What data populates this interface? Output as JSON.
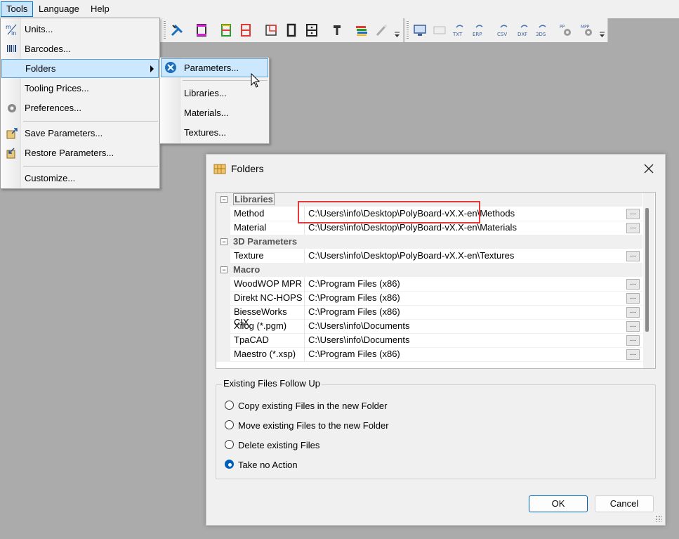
{
  "menubar": {
    "items": [
      "Tools",
      "Language",
      "Help"
    ]
  },
  "tools_menu": {
    "units": "Units...",
    "barcodes": "Barcodes...",
    "folders": "Folders",
    "tooling_prices": "Tooling Prices...",
    "preferences": "Preferences...",
    "save_parameters": "Save Parameters...",
    "restore_parameters": "Restore Parameters...",
    "customize": "Customize..."
  },
  "folders_submenu": {
    "parameters": "Parameters...",
    "libraries": "Libraries...",
    "materials": "Materials...",
    "textures": "Textures..."
  },
  "toolbar": {
    "icon_text_txt": "TXT",
    "icon_text_erp": "ERP",
    "icon_text_csv": "CSV",
    "icon_text_dxf": "DXF",
    "icon_text_3ds": "3DS",
    "icon_text_pp": "PP",
    "icon_text_mpp": "MPP"
  },
  "dialog": {
    "title": "Folders",
    "categories": {
      "libraries": "Libraries",
      "parameters3d": "3D Parameters",
      "macro": "Macro"
    },
    "rows": {
      "method": {
        "name": "Method",
        "value": "C:\\Users\\info\\Desktop\\PolyBoard-vX.X-en\\Methods"
      },
      "material": {
        "name": "Material",
        "value": "C:\\Users\\info\\Desktop\\PolyBoard-vX.X-en\\Materials"
      },
      "texture": {
        "name": "Texture",
        "value": "C:\\Users\\info\\Desktop\\PolyBoard-vX.X-en\\Textures"
      },
      "woodwop": {
        "name": "WoodWOP MPR",
        "value": "C:\\Program Files (x86)"
      },
      "direkt": {
        "name": "Direkt NC-HOPS",
        "value": "C:\\Program Files (x86)"
      },
      "biesse": {
        "name": "BiesseWorks CIX",
        "value": "C:\\Program Files (x86)"
      },
      "xilog": {
        "name": "Xilog (*.pgm)",
        "value": "C:\\Users\\info\\Documents"
      },
      "tpacad": {
        "name": "TpaCAD",
        "value": "C:\\Users\\info\\Documents"
      },
      "maestro": {
        "name": "Maestro (*.xsp)",
        "value": "C:\\Program Files (x86)"
      }
    },
    "browse_label": "...",
    "group": {
      "title": "Existing Files Follow Up",
      "options": {
        "copy": "Copy existing Files in the new Folder",
        "move": "Move existing Files to the new Folder",
        "delete": "Delete existing Files",
        "none": "Take no Action"
      },
      "selected": "Take no Action"
    },
    "ok": "OK",
    "cancel": "Cancel"
  },
  "colors": {
    "accent": "#0078d7",
    "highlight": "#cce8ff",
    "annotation": "#e5393c"
  }
}
